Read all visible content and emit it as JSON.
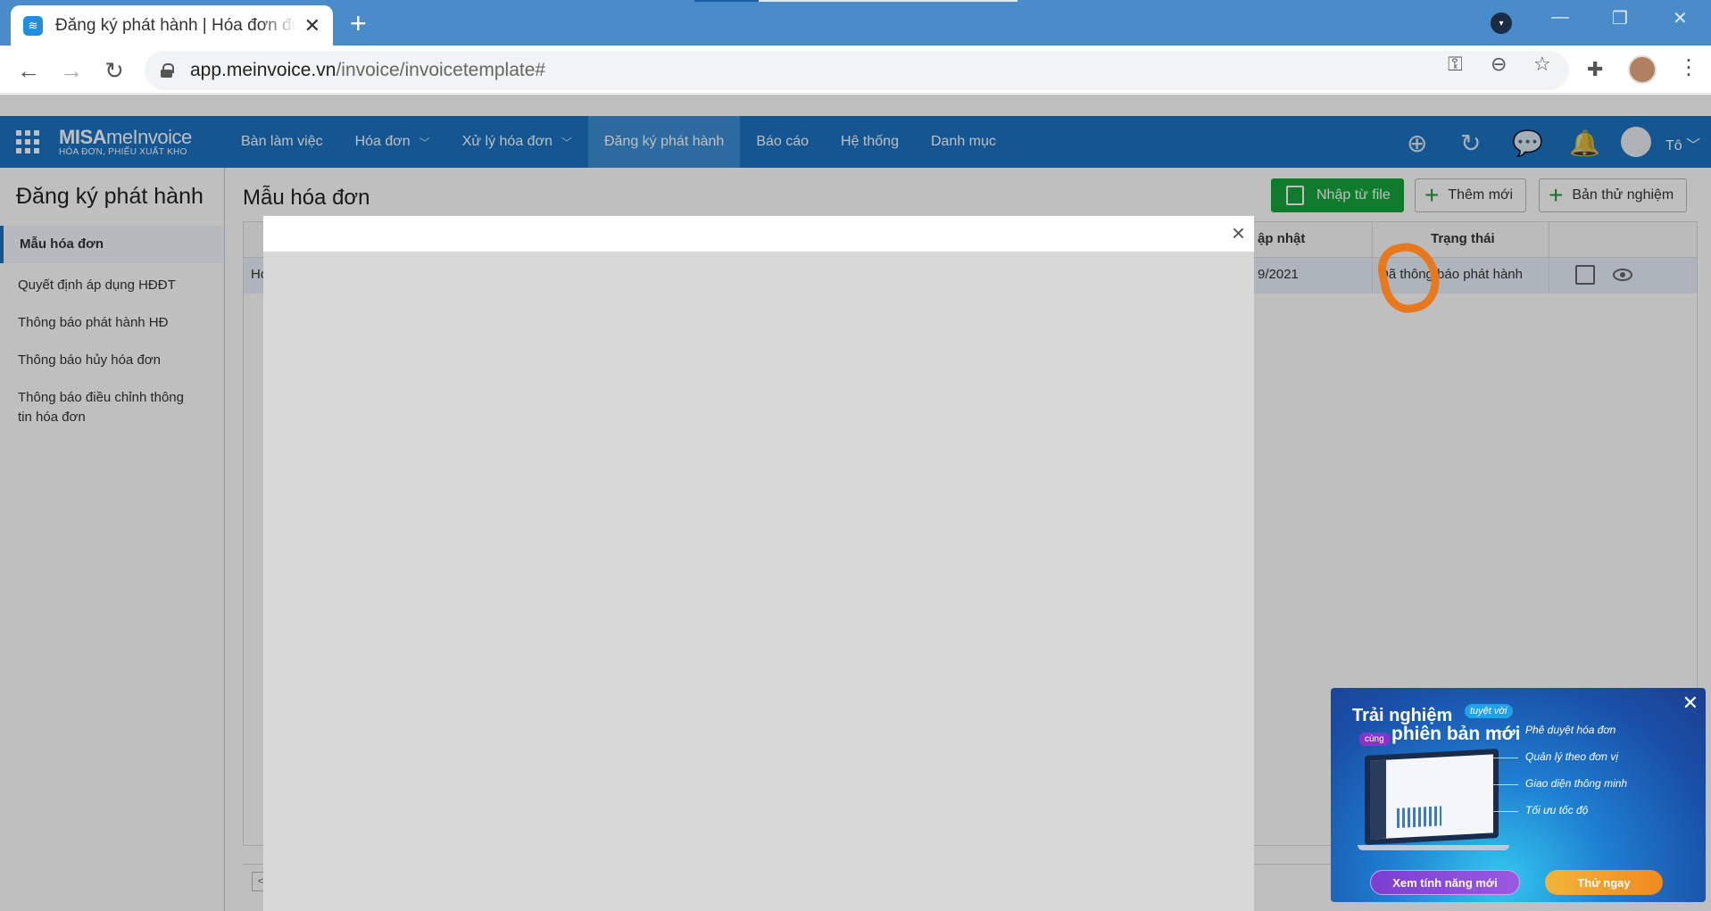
{
  "browser": {
    "tab_title": "Đăng ký phát hành | Hóa đơn điện tử",
    "url_host": "app.meinvoice.vn",
    "url_path": "/invoice/invoicetemplate#"
  },
  "brand": {
    "name_bold": "MISA",
    "name_light": "meInvoice",
    "tagline": "HÓA ĐƠN, PHIẾU XUẤT KHO"
  },
  "nav": {
    "items": [
      {
        "label": "Bàn làm việc",
        "dropdown": false,
        "active": false
      },
      {
        "label": "Hóa đơn",
        "dropdown": true,
        "active": false
      },
      {
        "label": "Xử lý hóa đơn",
        "dropdown": true,
        "active": false
      },
      {
        "label": "Đăng ký phát hành",
        "dropdown": false,
        "active": true
      },
      {
        "label": "Báo cáo",
        "dropdown": false,
        "active": false
      },
      {
        "label": "Hệ thống",
        "dropdown": false,
        "active": false
      },
      {
        "label": "Danh mục",
        "dropdown": false,
        "active": false
      }
    ],
    "user_name": "Tô"
  },
  "sidebar": {
    "title": "Đăng ký phát hành",
    "items": [
      {
        "label": "Mẫu hóa đơn",
        "active": true
      },
      {
        "label": "Quyết định áp dụng HĐĐT",
        "active": false
      },
      {
        "label": "Thông báo phát hành HĐ",
        "active": false
      },
      {
        "label": "Thông báo hủy hóa đơn",
        "active": false
      },
      {
        "label": "Thông báo điều chỉnh thông tin hóa đơn",
        "active": false
      }
    ]
  },
  "main": {
    "title": "Mẫu hóa đơn",
    "buttons": {
      "import": "Nhập từ file",
      "add_new": "Thêm mới",
      "trial": "Bản thử nghiệm"
    },
    "table": {
      "headers": {
        "updated": "ập nhật",
        "status": "Trạng thái"
      },
      "row": {
        "first_cell": "Ho",
        "updated": "9/2021",
        "status": "Đã thông báo phát hành"
      }
    },
    "pager_prev": "<"
  },
  "modal": {
    "close_symbol": "×"
  },
  "promo": {
    "headline1": "Trải nghiệm",
    "badge": "tuyệt vời",
    "cung": "cùng",
    "headline2": "phiên bản mới",
    "features": [
      "Phê duyệt hóa đơn",
      "Quản lý theo đơn vị",
      "Giao diện thông minh",
      "Tối ưu tốc độ"
    ],
    "btn_features": "Xem tính năng mới",
    "btn_try": "Thử ngay"
  }
}
